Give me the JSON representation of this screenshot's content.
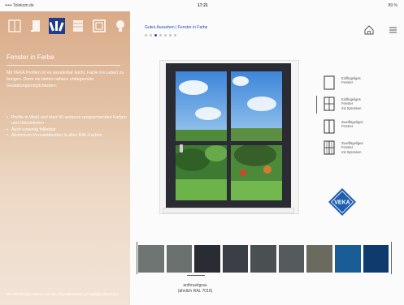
{
  "status": {
    "carrier": "••••• Telekom.de",
    "time": "17:21",
    "battery": "89 %"
  },
  "sidebar": {
    "tabs": [
      {
        "name": "tab-window-single",
        "icon": "window-icon",
        "active": false
      },
      {
        "name": "tab-door",
        "icon": "door-icon",
        "active": false
      },
      {
        "name": "tab-color",
        "icon": "color-fan-icon",
        "active": true
      },
      {
        "name": "tab-shutter",
        "icon": "shutter-icon",
        "active": false
      },
      {
        "name": "tab-frame",
        "icon": "frame-icon",
        "active": false
      },
      {
        "name": "tab-idea",
        "icon": "lightbulb-icon",
        "active": false
      }
    ],
    "title": "Fenster in Farbe",
    "paragraph": "Mit VEKA Profilen ist es wunderbar leicht, Farbe ins Leben zu bringen. Denn sie bieten nahezu unbegrenzte Gestaltungsmöglichkeiten:",
    "bullets": [
      "Profile in Weiß und über 50 weiteren ansprechenden Farben und Holzdekoren",
      "Auch einseitig foliierbar",
      "Aluminium-Vorsatzblenden in allen RAL-Farben"
    ],
    "footnote": "Die Abbildungen können von den Originalfarbtönen geringfügig abweichen."
  },
  "header": {
    "breadcrumb": "Gutes Aussehen | Fenster in Farbe",
    "dots_total": 7,
    "dots_active": 2
  },
  "options": [
    {
      "label": "Einflügeliges\nFenster",
      "icon": "single-pane-window-icon",
      "selected": false
    },
    {
      "label": "Einflügeliges\nFenster\nmit Sprossen",
      "icon": "single-pane-mullions-window-icon",
      "selected": true
    },
    {
      "label": "Zweiflügeliges\nFenster",
      "icon": "double-pane-window-icon",
      "selected": false
    },
    {
      "label": "Zweiflügeliges\nFenster\nmit Sprossen",
      "icon": "double-pane-mullions-window-icon",
      "selected": false
    }
  ],
  "logo": {
    "text": "VEKA"
  },
  "swatches": [
    "#6f7573",
    "#6b716f",
    "#2a2c33",
    "#3b3f45",
    "#4a4f52",
    "#555a5c",
    "#6b6a5f",
    "#1a5c96",
    "#0f3a6e"
  ],
  "selected_swatch": 2,
  "selected_color": {
    "line1": "anthrazitgrau",
    "line2": "(ähnlich RAL 7016)"
  },
  "colors": {
    "accent": "#1e50b4",
    "frame": "#2b2b33"
  }
}
